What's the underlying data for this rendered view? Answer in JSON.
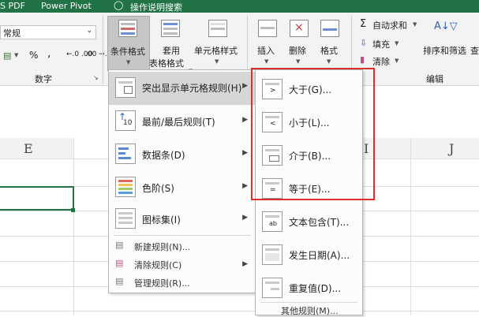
{
  "titlebar": {
    "pdf": "S PDF",
    "powerpivot": "Power Pivot",
    "search": "操作说明搜索"
  },
  "ribbon": {
    "number_format": "常规",
    "percent": "%",
    "comma": ",",
    "inc_decimal": "←.0 .00",
    "dec_decimal": ".00 →.0",
    "group_number": "数字",
    "conditional_format": "条件格式",
    "table_format_l1": "套用",
    "table_format_l2": "表格格式",
    "cell_styles": "单元格样式",
    "insert": "插入",
    "delete": "删除",
    "format": "格式",
    "autosum": "自动求和",
    "fill": "填充",
    "clear": "清除",
    "sort_filter": "排序和筛选",
    "find_select": "查找和选",
    "group_edit": "编辑"
  },
  "sheet": {
    "col_e": "E",
    "col_i": "I",
    "col_j": "J"
  },
  "cf_menu": {
    "items": [
      {
        "label": "突出显示单元格规则(H)"
      },
      {
        "label": "最前/最后规则(T)"
      },
      {
        "label": "数据条(D)"
      },
      {
        "label": "色阶(S)"
      },
      {
        "label": "图标集(I)"
      }
    ],
    "small": [
      {
        "label": "新建规则(N)..."
      },
      {
        "label": "清除规则(C)"
      },
      {
        "label": "管理规则(R)..."
      }
    ]
  },
  "sub_menu": {
    "items": [
      {
        "label": "大于(G)..."
      },
      {
        "label": "小于(L)..."
      },
      {
        "label": "介于(B)..."
      },
      {
        "label": "等于(E)..."
      },
      {
        "label": "文本包含(T)..."
      },
      {
        "label": "发生日期(A)..."
      },
      {
        "label": "重复值(D)..."
      }
    ],
    "more": "其他规则(M)..."
  }
}
